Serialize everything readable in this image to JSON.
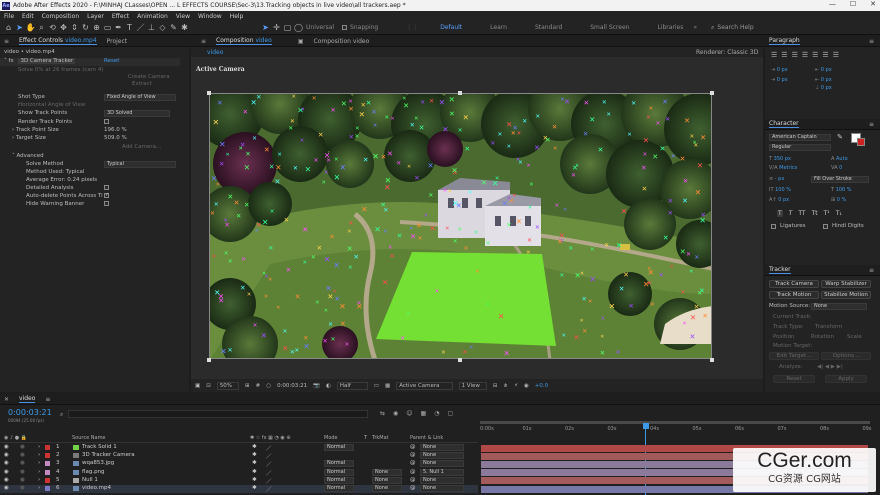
{
  "app": {
    "title": "Adobe After Effects 2020 - F:\\MINHAJ CLasses\\OPEN ... L EFFECTS COURSE\\Sec-3\\13.Tracking objects in live video\\all trackers.aep *",
    "icon_text": "Ae"
  },
  "menu": [
    "File",
    "Edit",
    "Composition",
    "Layer",
    "Effect",
    "Animation",
    "View",
    "Window",
    "Help"
  ],
  "toolbar": {
    "universal_label": "Universal",
    "snapping_label": "Snapping",
    "workspaces": [
      "Default",
      "Learn",
      "Standard",
      "Small Screen",
      "Libraries"
    ],
    "active_workspace": "Default",
    "search_placeholder": "Search Help"
  },
  "effect_controls": {
    "tab_label": "Effect Controls",
    "tab_layer": "video.mp4",
    "project_tab": "Project",
    "breadcrumb": "video • video.mp4",
    "effect_name": "3D Camera Tracker",
    "reset_label": "Reset",
    "disabled_line": "Solve 0% at 26 frames (cam 4)",
    "create_camera": "Create Camera",
    "extract": "Extract",
    "shot_type_label": "Shot Type",
    "shot_type_value": "Fixed Angle of View",
    "horizontal_aov": "Horizontal Angle of View",
    "show_track_points_label": "Show Track Points",
    "show_track_points_value": "3D Solved",
    "render_track_points": "Render Track Points",
    "track_point_size_label": "Track Point Size",
    "track_point_size_value": "196.0 %",
    "target_size_label": "Target Size",
    "target_size_value": "509.0 %",
    "add_camera_label": "Add Camera...",
    "advanced_label": "Advanced",
    "solve_method_label": "Solve Method",
    "solve_method_value": "Typical",
    "method_used": "Method Used: Typical",
    "average_error": "Average Error: 0.24 pixels",
    "detailed_analysis": "Detailed Analysis",
    "auto_delete": "Auto-delete Points Across Ti",
    "hide_warning": "Hide Warning Banner"
  },
  "composition": {
    "tab_label": "Composition",
    "tab_name": "video",
    "second_tab": "Composition video",
    "sub_tab": "video",
    "renderer_label": "Renderer:",
    "renderer_value": "Classic 3D",
    "active_camera_label": "Active Camera",
    "zoom": "50%",
    "timecode": "0:00:03:21",
    "resolution": "Half",
    "camera_view": "Active Camera",
    "views": "1 View",
    "exposure": "+0.0"
  },
  "paragraph": {
    "title": "Paragraph",
    "indent_values": [
      "0 px",
      "0 px",
      "0 px",
      "0 px",
      "0 px"
    ]
  },
  "character": {
    "title": "Character",
    "font_family": "American Captain",
    "font_style": "Regular",
    "font_size": "350 px",
    "leading": "Auto",
    "kerning": "Metrics",
    "tracking": "0",
    "stroke_width": "- px",
    "stroke_type": "Fill Over Stroke",
    "vertical_scale": "100 %",
    "horizontal_scale": "100 %",
    "baseline_shift": "0 px",
    "tsume": "0 %",
    "style_buttons": [
      "T",
      "T",
      "TT",
      "Tt",
      "T¹",
      "T₁"
    ],
    "ligatures": "Ligatures",
    "hindi_digits": "Hindi Digits"
  },
  "tracker": {
    "title": "Tracker",
    "track_camera": "Track Camera",
    "warp_stabilizer": "Warp Stabilizer",
    "track_motion": "Track Motion",
    "stabilize_motion": "Stabilize Motion",
    "motion_source_label": "Motion Source:",
    "motion_source_value": "None",
    "current_track_label": "Current Track:",
    "track_type_label": "Track Type:",
    "track_type_value": "Transform",
    "position": "Position",
    "rotation": "Rotation",
    "scale": "Scale",
    "motion_target": "Motion Target:",
    "edit_target": "Edit Target...",
    "options": "Options...",
    "analyze": "Analyze:",
    "reset": "Reset",
    "apply": "Apply"
  },
  "timeline": {
    "comp_tab": "video",
    "timecode": "0:00:03:21",
    "frame_info": "00094 (25.00 fps)",
    "columns": {
      "source_name": "Source Name",
      "mode": "Mode",
      "trkmat": "TrkMat",
      "parent": "Parent & Link"
    },
    "ruler": [
      "0:00s",
      "01s",
      "02s",
      "03s",
      "04s",
      "05s",
      "06s",
      "07s",
      "08s",
      "09s"
    ],
    "layers": [
      {
        "num": "1",
        "name": "Track Solid 1",
        "color": "#cc3333",
        "icon": "#74d14a",
        "mode": "Normal",
        "trkmat": "",
        "parent": "None",
        "bar_color": "#b04848"
      },
      {
        "num": "2",
        "name": "3D Tracker Camera",
        "color": "#cc3333",
        "icon": "#7a7a7a",
        "mode": "",
        "trkmat": "",
        "parent": "None",
        "bar_color": "#a25a5a"
      },
      {
        "num": "3",
        "name": "wqa853.jpg",
        "color": "#c48ac4",
        "icon": "#6a8ab0",
        "mode": "Normal",
        "trkmat": "",
        "parent": "None",
        "bar_color": "#8b7a9a"
      },
      {
        "num": "4",
        "name": "flag.png",
        "color": "#c48ac4",
        "icon": "#6a8ab0",
        "mode": "Normal",
        "trkmat": "None",
        "parent": "5. Null 1",
        "bar_color": "#8b7a9a"
      },
      {
        "num": "5",
        "name": "Null 1",
        "color": "#cc3333",
        "icon": "#aaaaaa",
        "mode": "Normal",
        "trkmat": "None",
        "parent": "None",
        "bar_color": "#a25a5a"
      },
      {
        "num": "6",
        "name": "video.mp4",
        "color": "#7a7ac8",
        "icon": "#6a8ab0",
        "mode": "Normal",
        "trkmat": "None",
        "parent": "None",
        "bar_color": "#7878a8"
      }
    ],
    "toggle_label": "Toggle Switches / Modes"
  },
  "watermark": {
    "line1": "CGer.com",
    "line2": "CG资源 CG网站"
  },
  "colors": {
    "accent": "#3d9ae8",
    "solid_green": "#74e033",
    "ui_bg": "#232323"
  }
}
